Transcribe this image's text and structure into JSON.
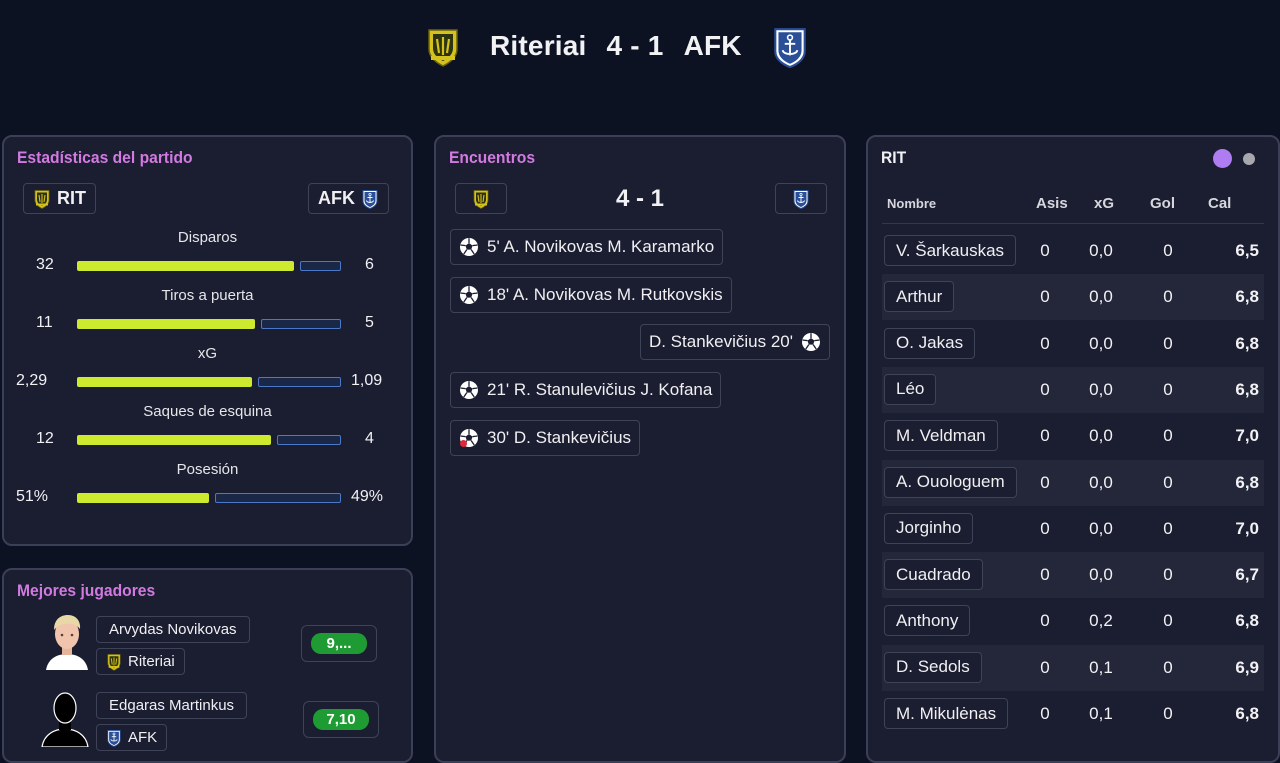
{
  "header": {
    "home_team": "Riteriai",
    "score": "4 - 1",
    "away_team": "AFK"
  },
  "stats": {
    "title": "Estadísticas del partido",
    "home_abbr": "RIT",
    "away_abbr": "AFK",
    "rows": [
      {
        "label": "Disparos",
        "home": "32",
        "away": "6",
        "home_share": 0.84
      },
      {
        "label": "Tiros a puerta",
        "home": "11",
        "away": "5",
        "home_share": 0.69
      },
      {
        "label": "xG",
        "home": "2,29",
        "away": "1,09",
        "home_share": 0.68
      },
      {
        "label": "Saques de esquina",
        "home": "12",
        "away": "4",
        "home_share": 0.75
      },
      {
        "label": "Posesión",
        "home": "51%",
        "away": "49%",
        "home_share": 0.51
      }
    ]
  },
  "best": {
    "title": "Mejores jugadores",
    "players": [
      {
        "name": "Arvydas Novikovas",
        "team": "Riteriai",
        "rating": "9,..."
      },
      {
        "name": "Edgaras Martinkus",
        "team": "AFK",
        "rating": "7,10"
      }
    ]
  },
  "encounters": {
    "title": "Encuentros",
    "score": "4 - 1",
    "events": [
      {
        "text": "5' A. Novikovas M. Karamarko",
        "side": "home",
        "icon": "football-icon"
      },
      {
        "text": "18' A. Novikovas M. Rutkovskis",
        "side": "home",
        "icon": "football-icon"
      },
      {
        "text": "D. Stankevičius 20'",
        "side": "away",
        "icon": "football-icon"
      },
      {
        "text": "21' R. Stanulevičius J. Kofana",
        "side": "home",
        "icon": "football-icon"
      },
      {
        "text": "30' D. Stankevičius",
        "side": "home",
        "icon": "own-goal-icon"
      }
    ]
  },
  "players_table": {
    "team": "RIT",
    "headers": {
      "name": "Nombre",
      "assists": "Asis",
      "xg": "xG",
      "goals": "Gol",
      "rating": "Cal"
    },
    "rows": [
      {
        "name": "V. Šarkauskas",
        "asis": "0",
        "xg": "0,0",
        "gol": "0",
        "cal": "6,5"
      },
      {
        "name": "Arthur",
        "asis": "0",
        "xg": "0,0",
        "gol": "0",
        "cal": "6,8"
      },
      {
        "name": "O. Jakas",
        "asis": "0",
        "xg": "0,0",
        "gol": "0",
        "cal": "6,8"
      },
      {
        "name": "Léo",
        "asis": "0",
        "xg": "0,0",
        "gol": "0",
        "cal": "6,8"
      },
      {
        "name": "M. Veldman",
        "asis": "0",
        "xg": "0,0",
        "gol": "0",
        "cal": "7,0"
      },
      {
        "name": "A. Ouologuem",
        "asis": "0",
        "xg": "0,0",
        "gol": "0",
        "cal": "6,8"
      },
      {
        "name": "Jorginho",
        "asis": "0",
        "xg": "0,0",
        "gol": "0",
        "cal": "7,0"
      },
      {
        "name": "Cuadrado",
        "asis": "0",
        "xg": "0,0",
        "gol": "0",
        "cal": "6,7"
      },
      {
        "name": "Anthony",
        "asis": "0",
        "xg": "0,2",
        "gol": "0",
        "cal": "6,8"
      },
      {
        "name": "D. Sedols",
        "asis": "0",
        "xg": "0,1",
        "gol": "0",
        "cal": "6,9"
      },
      {
        "name": "M. Mikulėnas",
        "asis": "0",
        "xg": "0,1",
        "gol": "0",
        "cal": "6,8"
      }
    ]
  },
  "colors": {
    "accent": "#d17ae0",
    "home_bar": "#cdea2f",
    "away_bar": "#4b78c7",
    "rating_green": "#1f9b33",
    "dot_active": "#b07cf2",
    "dot_inactive": "#a7a8ad"
  }
}
